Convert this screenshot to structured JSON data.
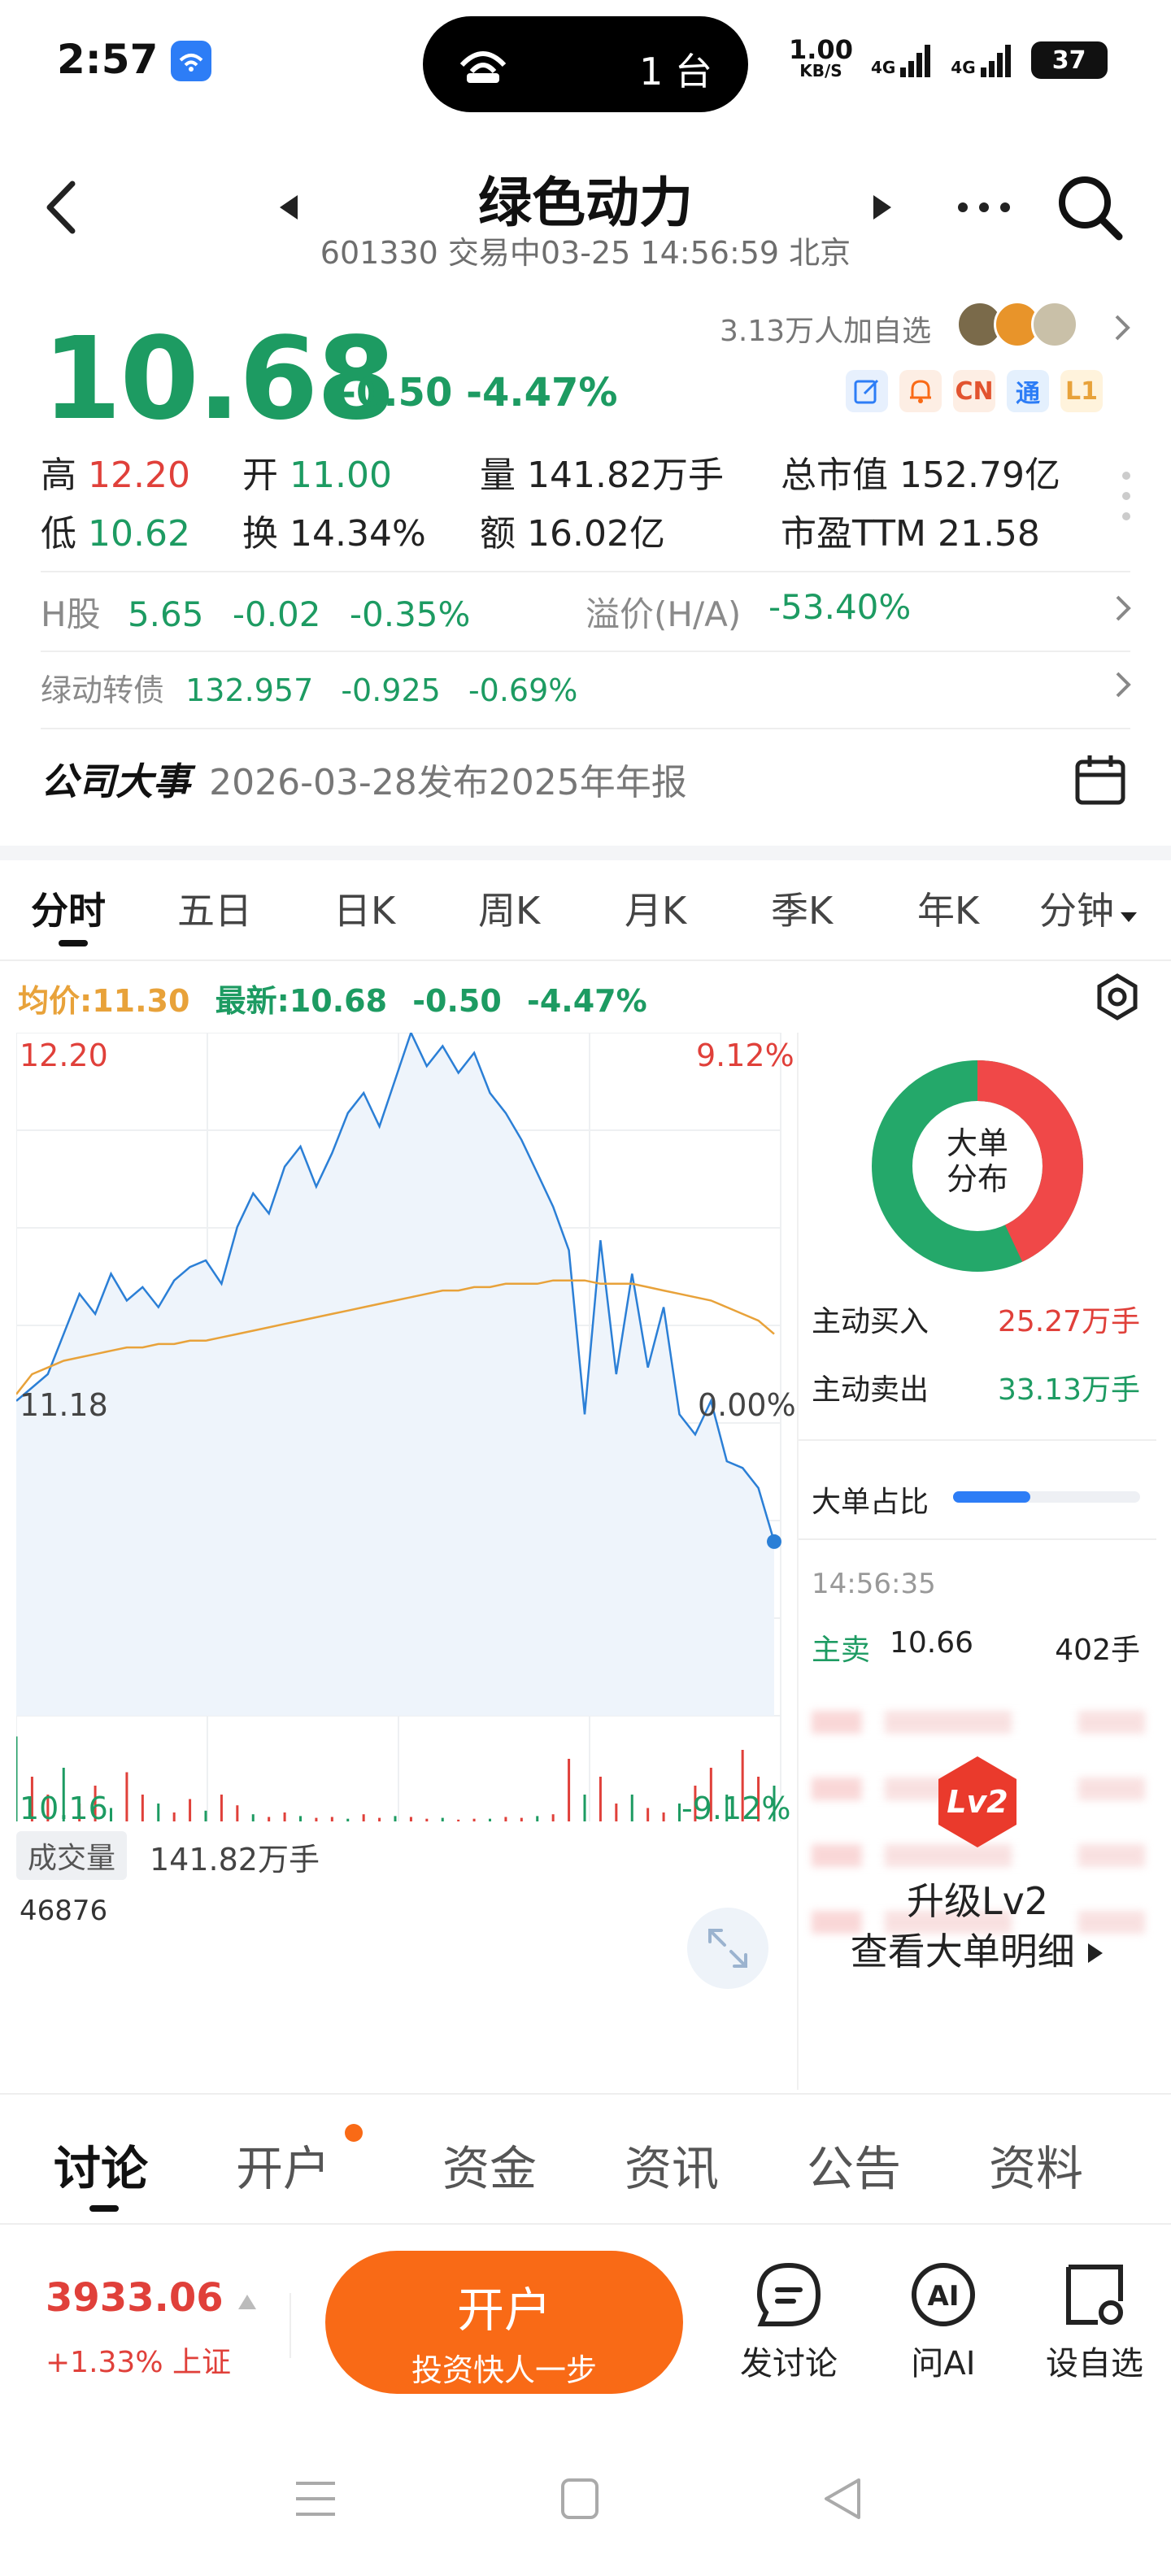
{
  "status_bar": {
    "time": "2:57",
    "island_count": "1 台",
    "net_speed_top": "1.00",
    "net_speed_unit": "KB/S",
    "sig1": "4G",
    "sig2": "4G",
    "battery": "37"
  },
  "header": {
    "title": "绿色动力",
    "subtitle": "601330 交易中03-25 14:56:59 北京"
  },
  "quote": {
    "price": "10.68",
    "change": "-0.50",
    "change_pct": "-4.47%",
    "watchers": "3.13万人加自选",
    "tags": [
      "CN",
      "通",
      "L1"
    ],
    "stats": [
      {
        "label": "高",
        "value": "12.20",
        "color": "red"
      },
      {
        "label": "开",
        "value": "11.00",
        "color": "green"
      },
      {
        "label": "量",
        "value": "141.82万手",
        "color": "plain"
      },
      {
        "label": "总市值",
        "value": "152.79亿",
        "color": "plain"
      },
      {
        "label": "低",
        "value": "10.62",
        "color": "green"
      },
      {
        "label": "换",
        "value": "14.34%",
        "color": "plain"
      },
      {
        "label": "额",
        "value": "16.02亿",
        "color": "plain"
      },
      {
        "label": "市盈TTM",
        "value": "21.58",
        "color": "plain"
      }
    ]
  },
  "h_share": {
    "label": "H股",
    "price": "5.65",
    "change": "-0.02",
    "pct": "-0.35%",
    "premium_label": "溢价(H/A)",
    "premium": "-53.40%"
  },
  "bond": {
    "label": "绿动转债",
    "price": "132.957",
    "change": "-0.925",
    "pct": "-0.69%"
  },
  "event": {
    "label": "公司大事",
    "text": "2026-03-28发布2025年年报"
  },
  "chart_tabs": [
    "分时",
    "五日",
    "日K",
    "周K",
    "月K",
    "季K",
    "年K",
    "分钟"
  ],
  "chart_info": {
    "avg_label": "均价:11.30",
    "latest_label": "最新:10.68",
    "change": "-0.50",
    "pct": "-4.47%"
  },
  "chart_data": {
    "type": "line",
    "title": "",
    "y_labels": {
      "top": "12.20",
      "mid": "11.18",
      "bottom": "10.16"
    },
    "pct_labels": {
      "top": "9.12%",
      "mid": "0.00%",
      "bottom": "-9.12%"
    },
    "ylim": [
      10.16,
      12.2
    ],
    "series": [
      {
        "values": [
          11.1,
          11.14,
          11.18,
          11.3,
          11.42,
          11.36,
          11.48,
          11.4,
          11.44,
          11.38,
          11.46,
          11.5,
          11.52,
          11.45,
          11.62,
          11.72,
          11.66,
          11.8,
          11.86,
          11.74,
          11.84,
          11.96,
          12.02,
          11.92,
          12.06,
          12.2,
          12.1,
          12.16,
          12.08,
          12.14,
          12.02,
          11.96,
          11.88,
          11.78,
          11.68,
          11.55,
          11.06,
          11.58,
          11.18,
          11.48,
          11.2,
          11.38,
          11.06,
          11.0,
          11.1,
          10.92,
          10.9,
          10.84,
          10.68
        ]
      },
      {
        "values": [
          11.12,
          11.18,
          11.2,
          11.22,
          11.23,
          11.24,
          11.25,
          11.26,
          11.26,
          11.27,
          11.27,
          11.28,
          11.28,
          11.29,
          11.3,
          11.31,
          11.32,
          11.33,
          11.34,
          11.35,
          11.36,
          11.37,
          11.38,
          11.39,
          11.4,
          11.41,
          11.42,
          11.43,
          11.43,
          11.44,
          11.44,
          11.45,
          11.45,
          11.45,
          11.46,
          11.46,
          11.46,
          11.45,
          11.45,
          11.45,
          11.44,
          11.43,
          11.42,
          11.41,
          11.4,
          11.38,
          11.36,
          11.34,
          11.3
        ]
      }
    ],
    "volume_label": "成交量",
    "volume_value": "141.82万手",
    "volume_max": "46876"
  },
  "side_panel": {
    "donut_label_1": "大单",
    "donut_label_2": "分布",
    "donut_red_fraction": 0.43,
    "buy_label": "主动买入",
    "buy_value": "25.27万手",
    "sell_label": "主动卖出",
    "sell_value": "33.13万手",
    "ratio_label": "大单占比",
    "trade_time": "14:56:35",
    "trade_type": "主卖",
    "trade_price": "10.66",
    "trade_qty": "402手",
    "upgrade_badge": "Lv2",
    "upgrade_title": "升级Lv2",
    "upgrade_sub": "查看大单明细"
  },
  "bottom_tabs": [
    "讨论",
    "开户",
    "资金",
    "资讯",
    "公告",
    "资料"
  ],
  "footer": {
    "index_value": "3933.06",
    "index_change": "+1.33% 上证",
    "open_title": "开户",
    "open_sub": "投资快人一步",
    "actions": [
      "发讨论",
      "问AI",
      "设自选"
    ]
  },
  "colors": {
    "up": "#e0403a",
    "down": "#1d9b62",
    "accent": "#f96a16",
    "avg_line": "#e8a23a",
    "price_line": "#2b7fd6"
  }
}
